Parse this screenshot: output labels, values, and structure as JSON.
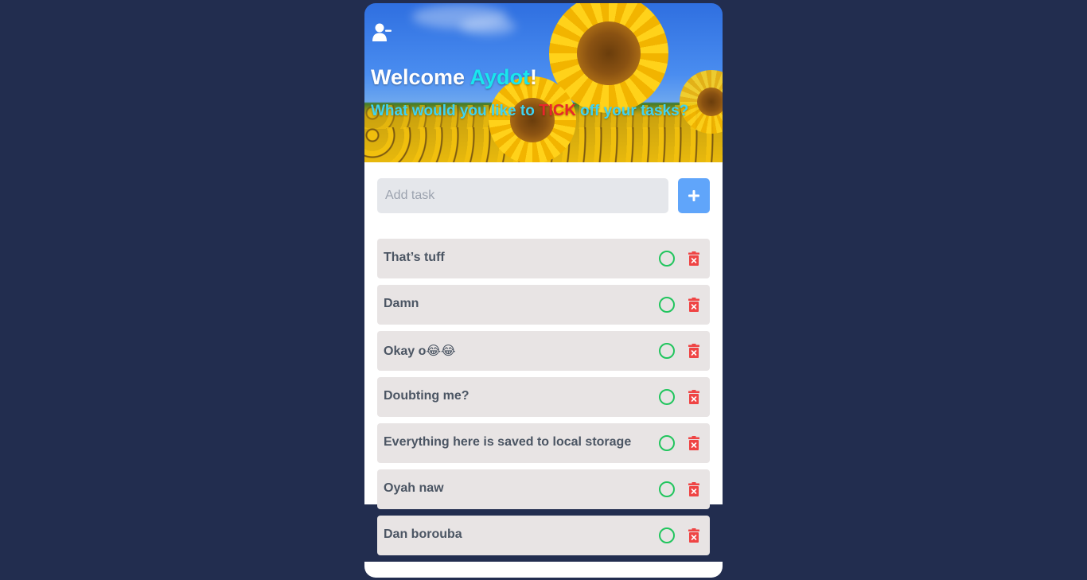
{
  "header": {
    "user_icon": "user-minus-icon",
    "welcome_prefix": "Welcome ",
    "user_name": "Aydot",
    "welcome_suffix": "!",
    "subtitle_before": "What would you like to ",
    "subtitle_emphasis": "TICK",
    "subtitle_after": " off your tasks?",
    "background": "sunflower-field-photo"
  },
  "add_task": {
    "placeholder": "Add task",
    "button_icon": "plus-icon"
  },
  "tasks": [
    {
      "label": "That’s tuff"
    },
    {
      "label": "Damn"
    },
    {
      "label": "Okay o😂😂"
    },
    {
      "label": "Doubting me?"
    },
    {
      "label": "Everything here is saved to local storage"
    },
    {
      "label": "Oyah naw"
    },
    {
      "label": "Dan borouba"
    }
  ],
  "task_actions": {
    "complete_icon": "circle-check-icon",
    "delete_icon": "trash-icon"
  },
  "colors": {
    "page_background": "#222d4f",
    "name_accent": "#19e6ee",
    "subtitle": "#3fd3f2",
    "tick_emphasis": "#e8262b",
    "add_button": "#60a5fa",
    "complete_ring": "#22c55e",
    "delete_icon": "#ef4444",
    "task_background": "#e8e4e4"
  }
}
